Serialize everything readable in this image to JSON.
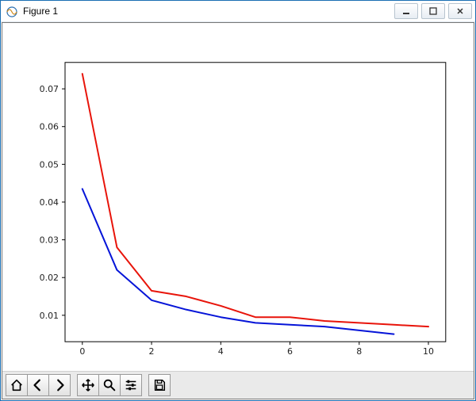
{
  "window": {
    "title": "Figure 1"
  },
  "chart_data": {
    "type": "line",
    "x": [
      0,
      1,
      2,
      3,
      4,
      5,
      6,
      7,
      8,
      9,
      10
    ],
    "series": [
      {
        "name": "red",
        "color": "#e8140a",
        "values": [
          0.074,
          0.028,
          0.0165,
          0.015,
          0.0125,
          0.0095,
          0.0095,
          0.0085,
          0.008,
          0.0075,
          0.007
        ]
      },
      {
        "name": "blue",
        "color": "#0514d8",
        "values": [
          0.0435,
          0.022,
          0.014,
          0.0115,
          0.0095,
          0.008,
          0.0075,
          0.007,
          0.006,
          0.005,
          null
        ]
      }
    ],
    "xlim": [
      -0.5,
      10.5
    ],
    "ylim": [
      0.003,
      0.077
    ],
    "xticks": [
      0,
      2,
      4,
      6,
      8,
      10
    ],
    "yticks": [
      0.01,
      0.02,
      0.03,
      0.04,
      0.05,
      0.06,
      0.07
    ],
    "xlabel": "",
    "ylabel": "",
    "title": ""
  },
  "window_controls": {
    "minimize": "Minimize",
    "maximize": "Maximize",
    "close": "Close"
  },
  "toolbar": {
    "home": "Home",
    "back": "Back",
    "forward": "Forward",
    "pan": "Pan",
    "zoom": "Zoom",
    "subplots": "Configure subplots",
    "save": "Save"
  }
}
